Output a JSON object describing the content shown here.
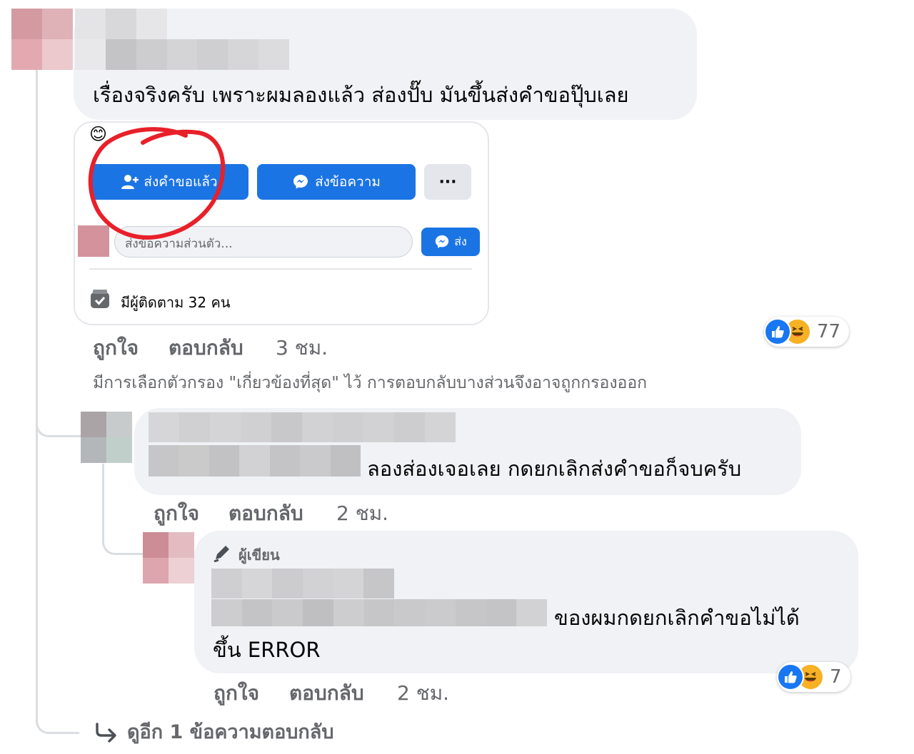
{
  "comment1": {
    "text": "เรื่องจริงครับ เพราะผมลองแล้ว ส่องปั๊บ มันขึ้นส่งคำขอปุ๊บเลย",
    "attachment": {
      "emoji": "😊",
      "request_button": "ส่งคำขอแล้ว",
      "message_button": "ส่งข้อความ",
      "more_button": "···",
      "message_placeholder": "ส่งข้อความส่วนตัว...",
      "send_button": "ส่ง",
      "followers": "มีผู้ติดตาม 32 คน"
    },
    "like": "ถูกใจ",
    "reply": "ตอบกลับ",
    "time": "3 ชม.",
    "reaction_count": "77"
  },
  "filter_notice": "มีการเลือกตัวกรอง \"เกี่ยวข้องที่สุด\" ไว้ การตอบกลับบางส่วนจึงอาจถูกกรองออก",
  "reply1": {
    "text": "ลองส่องเจอเลย กดยกเลิกส่งคำขอก็จบครับ",
    "like": "ถูกใจ",
    "reply": "ตอบกลับ",
    "time": "2 ชม."
  },
  "reply2": {
    "author_badge": "ผู้เขียน",
    "text_line1": "ของผมกดยกเลิกคำขอไม่ได้",
    "text_line2": "ขึ้น ERROR",
    "like": "ถูกใจ",
    "reply": "ตอบกลับ",
    "time": "2 ชม.",
    "reaction_count": "7"
  },
  "view_more": "ดูอีก 1 ข้อความตอบกลับ",
  "colors": {
    "bubble": "#f0f2f5",
    "fb_blue": "#1b74e4",
    "annotation_red": "#e8202a",
    "secondary_text": "#65676b"
  }
}
